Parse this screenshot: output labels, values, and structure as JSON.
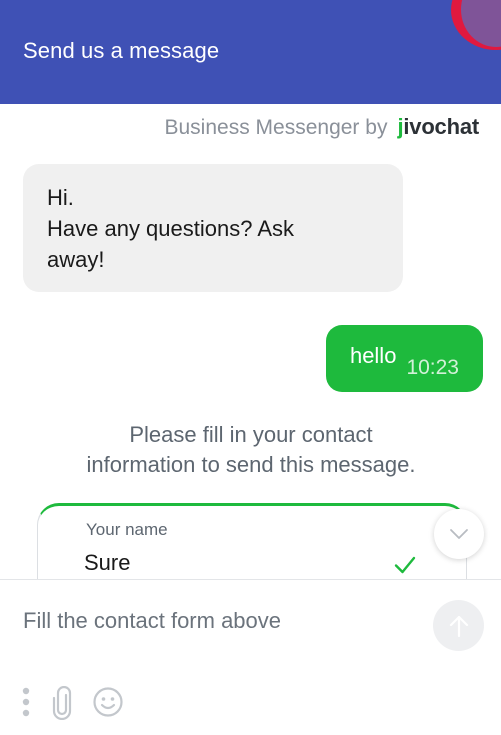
{
  "header": {
    "title": "Send us a message",
    "color": "#3f51b5"
  },
  "brand": {
    "prefix": "Business Messenger by",
    "logo_first": "j",
    "logo_rest": "ivochat"
  },
  "messages": {
    "incoming_lines": [
      "Hi.",
      "Have any questions? Ask",
      "away!"
    ],
    "outgoing_text": "hello",
    "outgoing_time": "10:23",
    "accent": "#1eba3d"
  },
  "notice": {
    "line1": "Please fill in your contact",
    "line2": "information to send this message."
  },
  "contact_form": {
    "name_label": "Your name",
    "name_value": "Sure"
  },
  "composer": {
    "placeholder": "Fill the contact form above"
  },
  "icons": {
    "menu": "more-vertical-icon",
    "attach": "paperclip-icon",
    "emoji": "smiley-icon",
    "send": "arrow-up-icon",
    "scroll": "chevron-down-icon",
    "valid": "checkmark-icon"
  }
}
